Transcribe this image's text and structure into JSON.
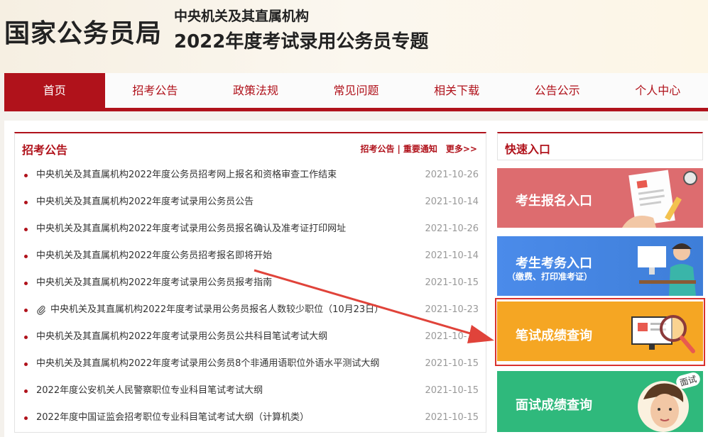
{
  "header": {
    "logo": "国家公务员局",
    "subtitle1": "中央机关及其直属机构",
    "subtitle2": "2022年度考试录用公务员专题"
  },
  "nav": {
    "items": [
      "首页",
      "招考公告",
      "政策法规",
      "常见问题",
      "相关下载",
      "公告公示",
      "个人中心"
    ]
  },
  "announcements": {
    "title": "招考公告",
    "link1": "招考公告",
    "separator": "|",
    "link2": "重要通知",
    "more": "更多>>",
    "items": [
      {
        "title": "中央机关及其直属机构2022年度公务员招考网上报名和资格审查工作结束",
        "date": "2021-10-26"
      },
      {
        "title": "中央机关及其直属机构2022年度考试录用公务员公告",
        "date": "2021-10-14"
      },
      {
        "title": "中央机关及其直属机构2022年度考试录用公务员报名确认及准考证打印网址",
        "date": "2021-10-26"
      },
      {
        "title": "中央机关及其直属机构2022年度公务员招考报名即将开始",
        "date": "2021-10-14"
      },
      {
        "title": "中央机关及其直属机构2022年度考试录用公务员报考指南",
        "date": "2021-10-15"
      },
      {
        "title": "中央机关及其直属机构2022年度考试录用公务员报名人数较少职位（10月23日）",
        "date": "2021-10-23"
      },
      {
        "title": "中央机关及其直属机构2022年度考试录用公务员公共科目笔试考试大纲",
        "date": "2021-10-15"
      },
      {
        "title": "中央机关及其直属机构2022年度考试录用公务员8个非通用语职位外语水平测试大纲",
        "date": "2021-10-15"
      },
      {
        "title": "2022年度公安机关人民警察职位专业科目笔试考试大纲",
        "date": "2021-10-15"
      },
      {
        "title": "2022年度中国证监会招考职位专业科目笔试考试大纲（计算机类）",
        "date": "2021-10-15"
      }
    ]
  },
  "quick": {
    "title": "快速入口",
    "entry1": "考生报名入口",
    "entry2": "考生考务入口",
    "entry2_sub": "（缴费、打印准考证）",
    "entry3": "笔试成绩查询",
    "entry4": "面试成绩查询",
    "entry4_badge": "面试"
  },
  "colors": {
    "brand_red": "#b0121b",
    "entry1": "#dd6c6f",
    "entry2": "#4b8bea",
    "entry3": "#f5a623",
    "entry4": "#2fb97c",
    "highlight": "#d9322e"
  }
}
